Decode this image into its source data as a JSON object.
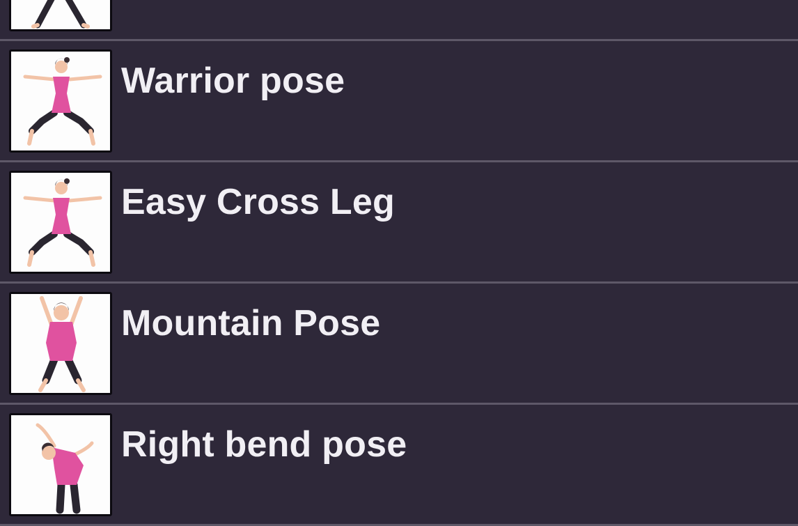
{
  "items": [
    {
      "label": "",
      "icon": "standing-pose-figure-icon"
    },
    {
      "label": "Warrior pose",
      "icon": "warrior-pose-figure-icon"
    },
    {
      "label": "Easy Cross Leg",
      "icon": "warrior-pose-figure-icon"
    },
    {
      "label": "Mountain Pose",
      "icon": "arms-up-pose-figure-icon"
    },
    {
      "label": "Right bend pose",
      "icon": "side-bend-pose-figure-icon"
    }
  ],
  "colors": {
    "background": "#2e2839",
    "divider": "#5e5868",
    "text": "#f1eff4",
    "top_pink": "#e0529f",
    "skin": "#f2c3a7",
    "pants": "#2a2630"
  }
}
